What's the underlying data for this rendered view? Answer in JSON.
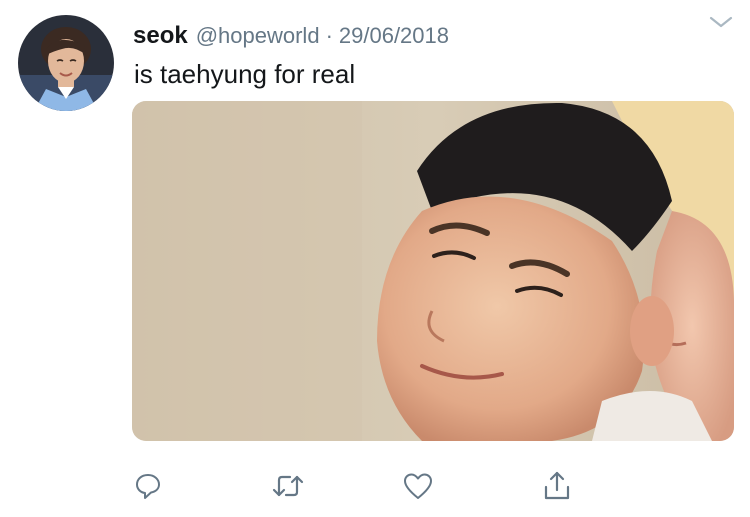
{
  "tweet": {
    "display_name": "seok",
    "handle": "@hopeworld",
    "separator": "·",
    "date": "29/06/2018",
    "text": "is taehyung for real"
  },
  "icons": {
    "avatar": "profile-avatar",
    "menu": "chevron-down-icon",
    "reply": "reply-icon",
    "retweet": "retweet-icon",
    "like": "heart-icon",
    "share": "share-icon"
  },
  "colors": {
    "name": "#14171a",
    "secondary": "#657786",
    "icon": "#657786"
  }
}
